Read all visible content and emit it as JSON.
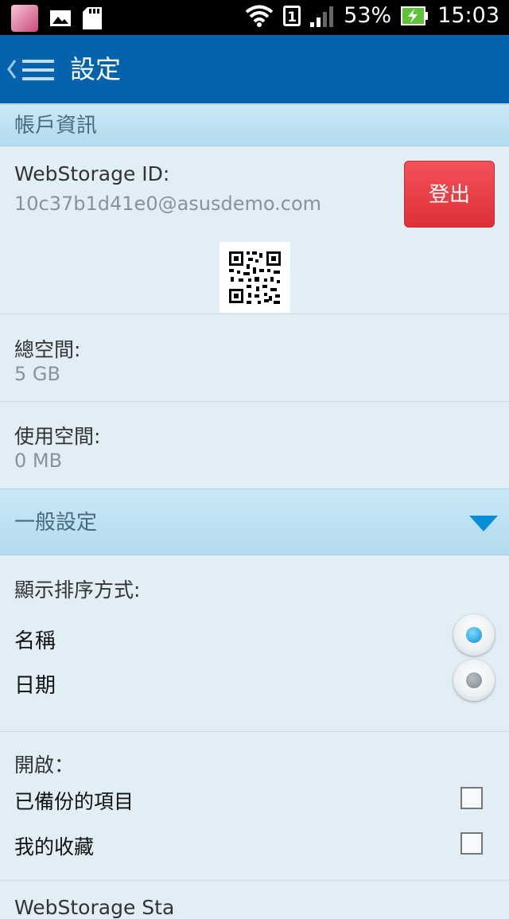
{
  "status_bar": {
    "battery": "53%",
    "time": "15:03",
    "sim_label": "1",
    "icons": [
      "app-avatar-icon",
      "gallery-icon",
      "sd-card-icon",
      "wifi-icon",
      "sim-icon",
      "signal-icon",
      "battery-charging-icon"
    ]
  },
  "app_bar": {
    "title": "設定",
    "color": "#0563ae"
  },
  "account_section": {
    "header": "帳戶資訊",
    "id_label": "WebStorage ID:",
    "id_value": "10c37b1d41e0@asusdemo.com",
    "logout_label": "登出",
    "logout_color": "#e83a40",
    "total_space_label": "總空間:",
    "total_space_value": "5 GB",
    "used_space_label": "使用空間:",
    "used_space_value": "0 MB"
  },
  "general_section": {
    "header": "一般設定",
    "sort_label": "顯示排序方式:",
    "sort_options": [
      {
        "label": "名稱",
        "selected": true
      },
      {
        "label": "日期",
        "selected": false
      }
    ],
    "open_label": "開啟：",
    "open_options": [
      {
        "label": "已備份的項目",
        "checked": false
      },
      {
        "label": "我的收藏",
        "checked": false
      }
    ],
    "next_item_partial": "WebStorage Sta"
  }
}
